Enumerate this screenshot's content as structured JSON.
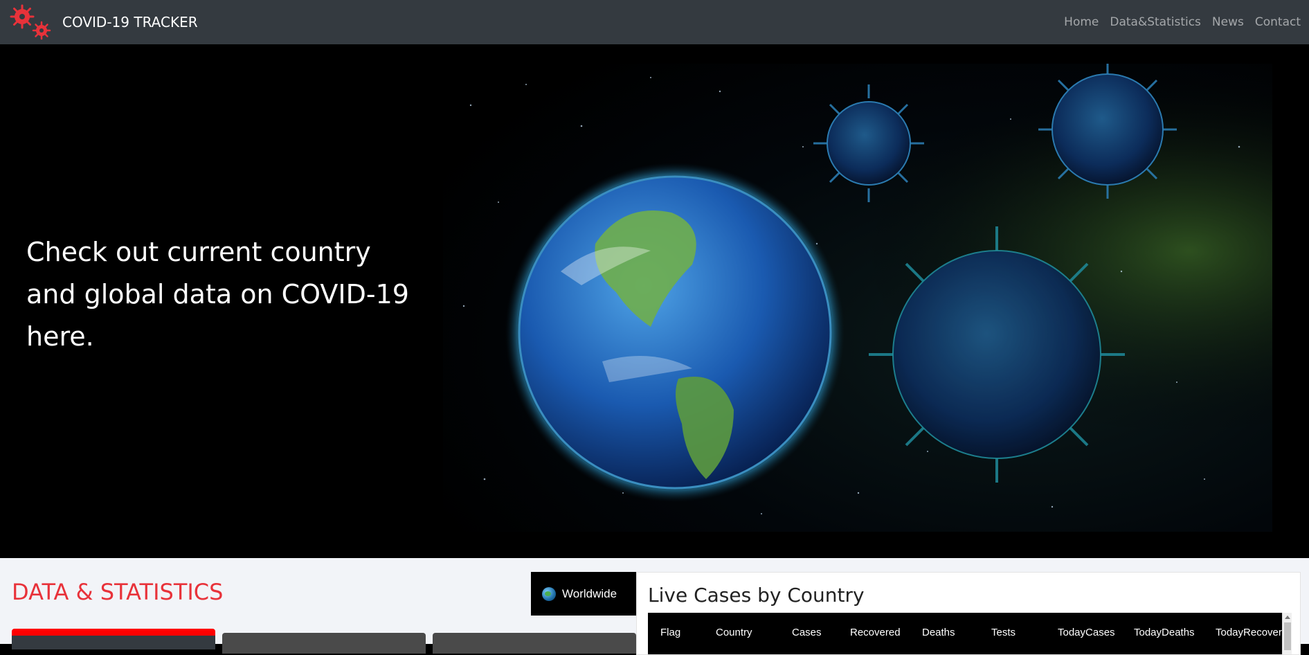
{
  "brand": {
    "name": "COVID-19 TRACKER",
    "color": "#e8323a"
  },
  "nav": {
    "items": [
      "Home",
      "Data&Statistics",
      "News",
      "Contact"
    ]
  },
  "hero": {
    "text": "Check out current country and global data on COVID-19 here."
  },
  "stats": {
    "title": "DATA & STATISTICS",
    "worldwide_label": "Worldwide"
  },
  "live": {
    "title": "Live Cases by Country",
    "columns": [
      "Flag",
      "Country",
      "Cases",
      "Recovered",
      "Deaths",
      "Tests",
      "TodayCases",
      "TodayDeaths",
      "TodayRecovered"
    ]
  }
}
